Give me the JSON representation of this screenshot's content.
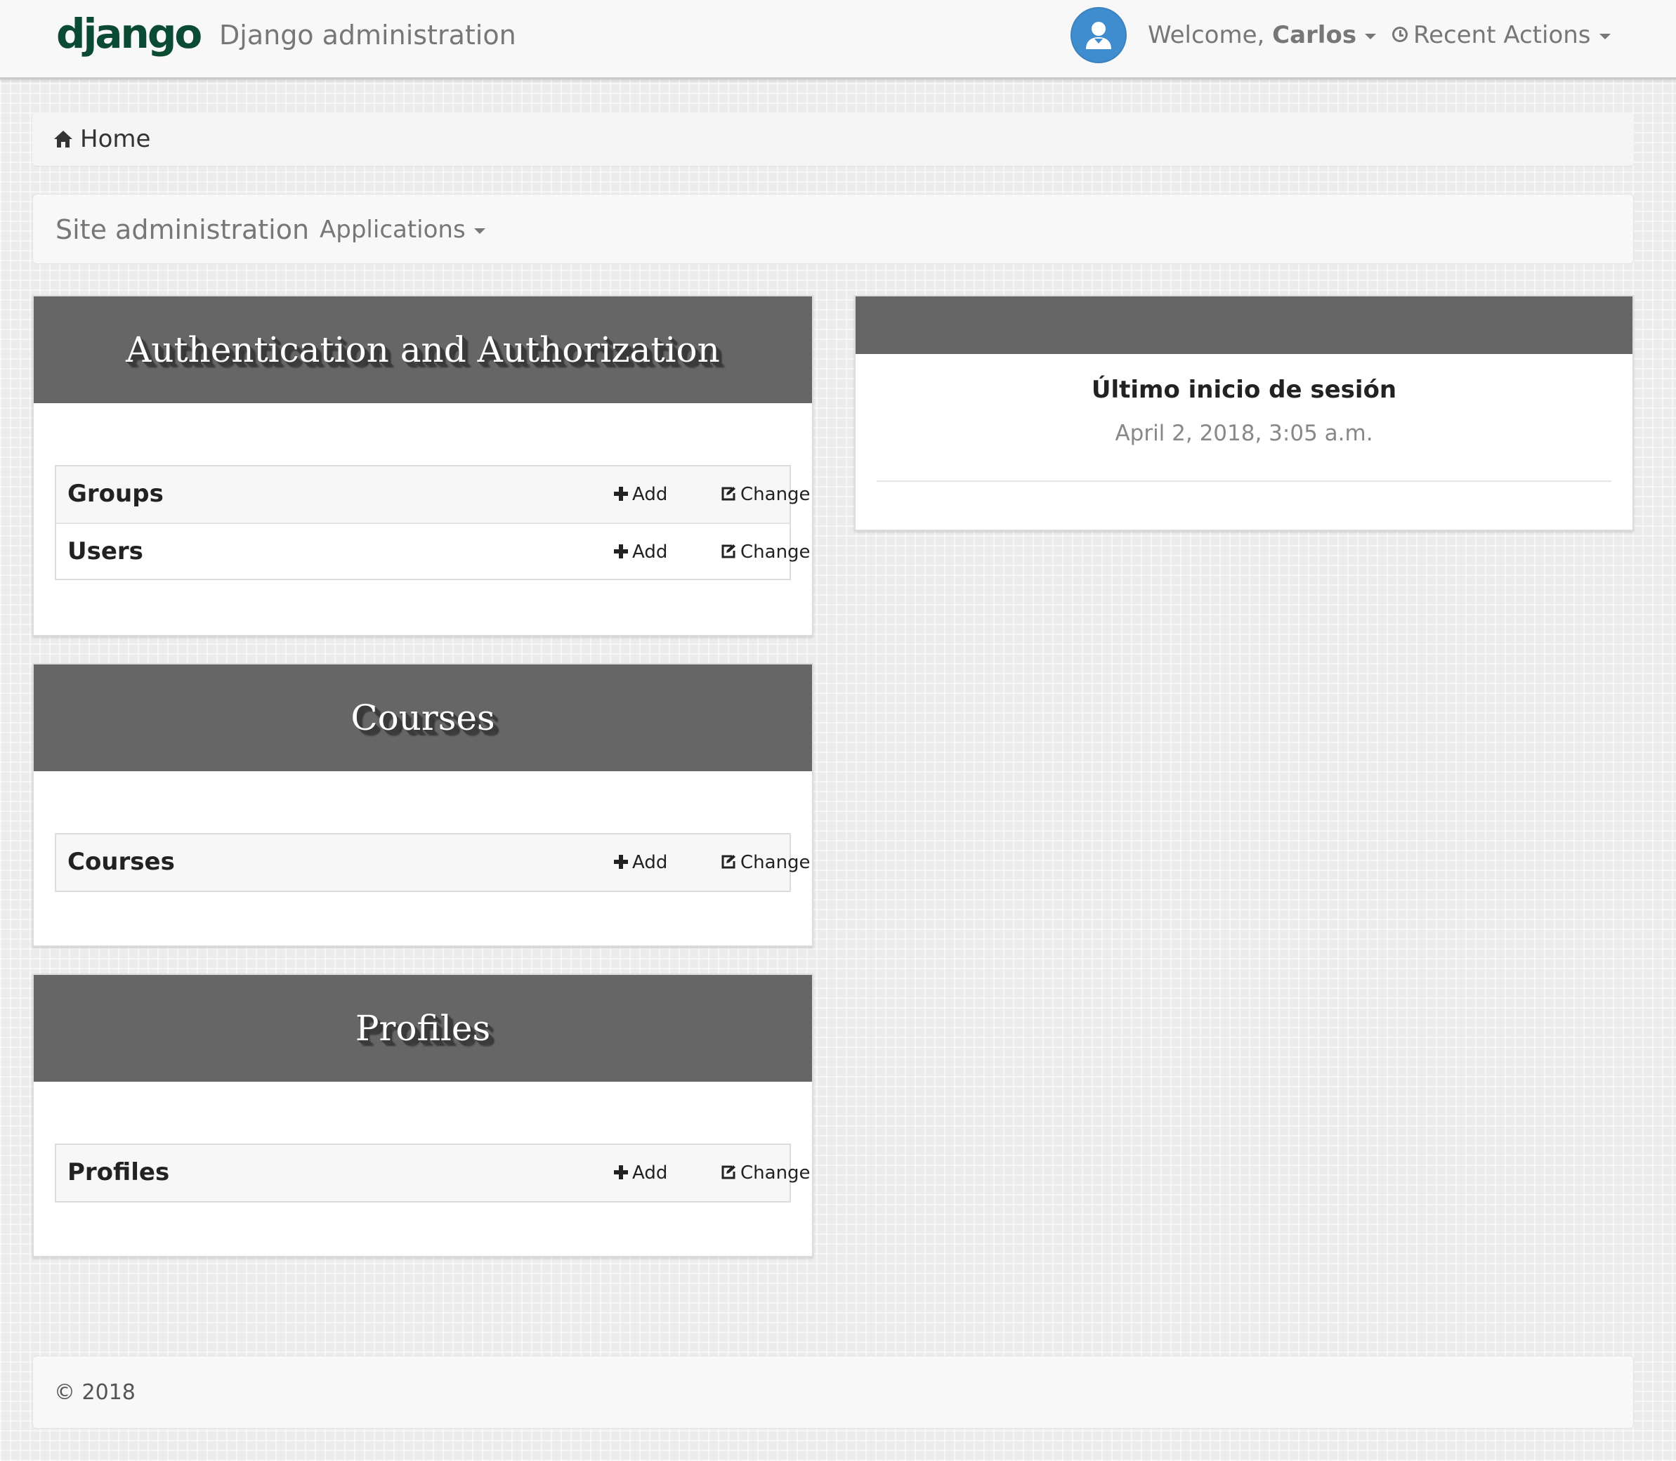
{
  "navbar": {
    "logo_text": "django",
    "title": "Django administration",
    "welcome_prefix": "Welcome, ",
    "username": "Carlos",
    "recent_actions": "Recent Actions"
  },
  "breadcrumb": {
    "home": "Home"
  },
  "subnav": {
    "site_admin": "Site administration",
    "applications": "Applications"
  },
  "apps": [
    {
      "title": "Authentication and Authorization",
      "models": [
        {
          "name": "Groups",
          "add": "Add",
          "change": "Change"
        },
        {
          "name": "Users",
          "add": "Add",
          "change": "Change"
        }
      ]
    },
    {
      "title": "Courses",
      "models": [
        {
          "name": "Courses",
          "add": "Add",
          "change": "Change"
        }
      ]
    },
    {
      "title": "Profiles",
      "models": [
        {
          "name": "Profiles",
          "add": "Add",
          "change": "Change"
        }
      ]
    }
  ],
  "last_login": {
    "heading": "Último inicio de sesión",
    "date": "April 2, 2018, 3:05 a.m."
  },
  "footer": {
    "copyright": "© 2018"
  },
  "colors": {
    "brand": "#0c4b33",
    "panel_header": "#666666",
    "avatar": "#3f8ccf"
  },
  "icons": [
    "user-avatar-icon",
    "clock-icon",
    "home-icon",
    "plus-icon",
    "edit-icon",
    "caret-down-icon"
  ]
}
